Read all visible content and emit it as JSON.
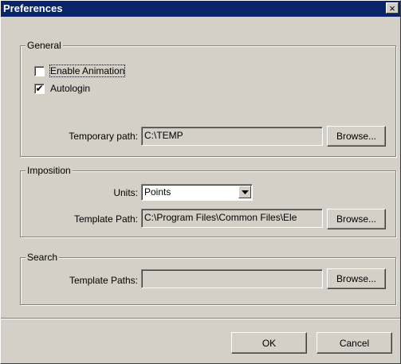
{
  "window": {
    "title": "Preferences",
    "close_glyph": "×"
  },
  "general": {
    "label": "General",
    "enable_animation": {
      "label": "Enable Animation",
      "checked": false
    },
    "autologin": {
      "label": "Autologin",
      "checked": true,
      "check_glyph": "✔"
    },
    "temporary_path": {
      "label": "Temporary path:",
      "value": "C:\\TEMP",
      "browse_label": "Browse..."
    }
  },
  "imposition": {
    "label": "Imposition",
    "units": {
      "label": "Units:",
      "value": "Points"
    },
    "template_path": {
      "label": "Template Path:",
      "value": "C:\\Program Files\\Common Files\\Ele",
      "browse_label": "Browse..."
    }
  },
  "search": {
    "label": "Search",
    "template_paths": {
      "label": "Template Paths:",
      "value": "",
      "browse_label": "Browse..."
    }
  },
  "footer": {
    "ok_label": "OK",
    "cancel_label": "Cancel"
  },
  "colors": {
    "titlebar": "#0a246a",
    "face": "#d4d0c8"
  }
}
